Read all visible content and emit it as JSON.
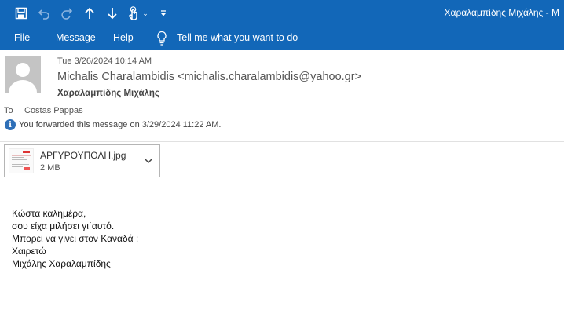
{
  "window": {
    "title": "Χαραλαμπίδης Μιχάλης  -  M"
  },
  "quick_access": [
    {
      "icon": "save-icon"
    },
    {
      "icon": "undo-icon"
    },
    {
      "icon": "redo-icon"
    },
    {
      "icon": "arrow-up-icon"
    },
    {
      "icon": "arrow-down-icon"
    },
    {
      "icon": "touch-mode-icon"
    },
    {
      "icon": "customize-toolbar-icon"
    }
  ],
  "menu": {
    "file": "File",
    "message": "Message",
    "help": "Help",
    "tell_me": "Tell me what you want to do"
  },
  "email": {
    "date": "Tue 3/26/2024 10:14 AM",
    "from": "Michalis Charalambidis <michalis.charalambidis@yahoo.gr>",
    "subject": "Χαραλαμπίδης Μιχάλης",
    "to_label": "To",
    "to": "Costas Pappas",
    "forwarded_notice": "You forwarded this message on 3/29/2024 11:22 AM.",
    "attachment": {
      "name": "ΑΡΓΥΡΟΥΠΟΛΗ.jpg",
      "size": "2 MB"
    },
    "body_lines": [
      "Κώστα καλημέρα,",
      "σου είχα μιλήσει γι΄αυτό.",
      "Μπορεί να γίνει στον Καναδά ;",
      "Χαιρετώ",
      "Μιχάλης Χαραλαμπίδης"
    ]
  },
  "colors": {
    "accent": "#1267b8",
    "info": "#2e6fb7"
  }
}
